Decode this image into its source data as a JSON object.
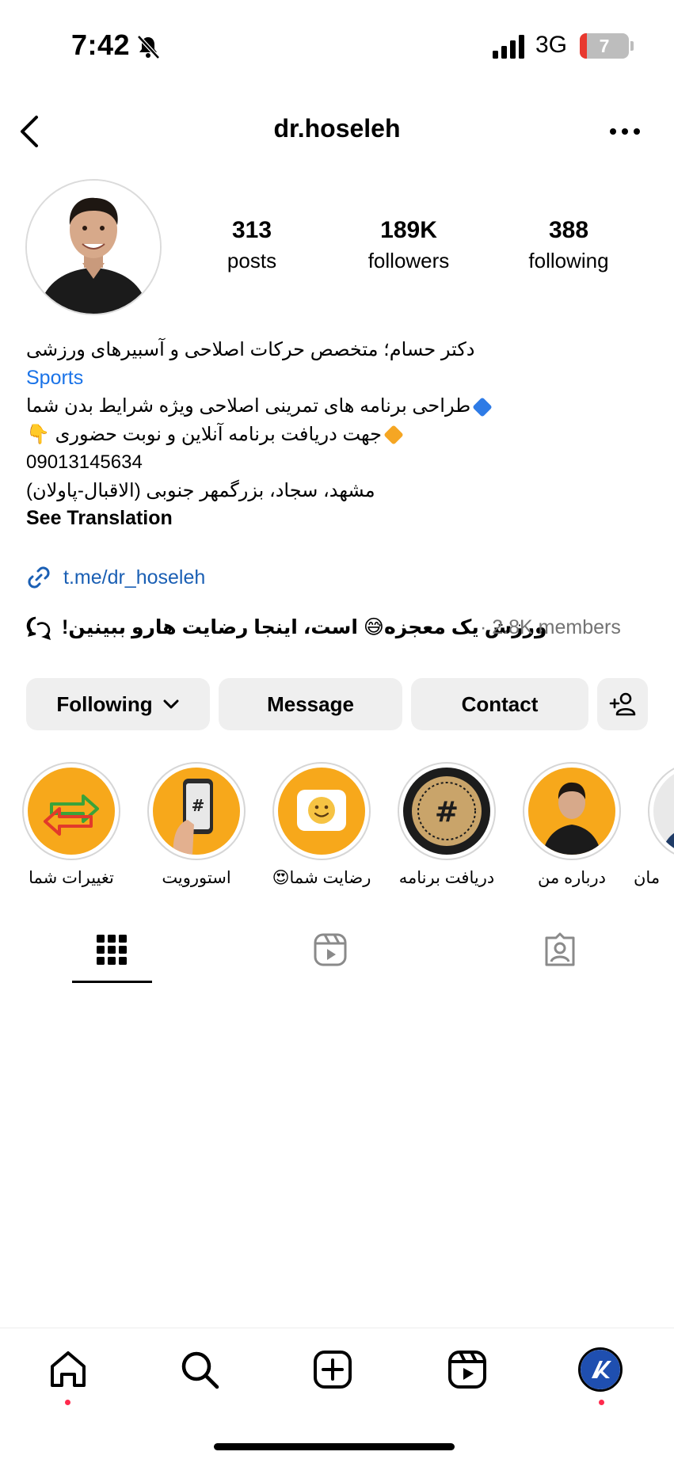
{
  "status_bar": {
    "time": "7:42",
    "network": "3G",
    "battery": "7",
    "battery_level_percent": 7
  },
  "header": {
    "username": "dr.hoseleh",
    "back_icon": "chevron-left-icon",
    "more_icon": "more-horizontal-icon"
  },
  "stats": [
    {
      "value": "313",
      "label": "posts"
    },
    {
      "value": "189K",
      "label": "followers"
    },
    {
      "value": "388",
      "label": "following"
    }
  ],
  "bio": {
    "name_line": "دکتر حسام؛ متخصص حرکات اصلاحی و آسبیرهای ورزشی",
    "category": "Sports",
    "line1": "طراحی برنامه های تمرینی اصلاحی ویژه شرایط بدن شما",
    "line2": "جهت دریافت برنامه آنلاین و نوبت حضوری",
    "line2_emoji": "👇",
    "phone": "09013145634",
    "address": "مشهد، سجاد، بزرگمهر جنوبی (الاقبال-پاولان)",
    "see_translation": "See Translation"
  },
  "link": {
    "text": "t.me/dr_hoseleh"
  },
  "channel": {
    "title": "ورزش یک معجزه😅 است، اینجا رضایت هارو ببینین!",
    "members": "· 2.8K members"
  },
  "buttons": {
    "following": "Following",
    "message": "Message",
    "contact": "Contact"
  },
  "highlights": [
    {
      "label": "تغییرات شما"
    },
    {
      "label": "استورویت"
    },
    {
      "label": "رضایت شما😍"
    },
    {
      "label": "دریافت برنامه"
    },
    {
      "label": "درباره من"
    },
    {
      "label": "مان"
    }
  ],
  "tabs": [
    "grid-icon",
    "reels-icon",
    "tagged-icon"
  ],
  "bottom_nav": [
    "home-icon",
    "search-icon",
    "create-icon",
    "reels-icon",
    "profile-avatar"
  ],
  "colors": {
    "accent_blue": "#1a73e8",
    "highlight_orange": "#f39c12",
    "notification_dot": "#ff2a4d"
  }
}
